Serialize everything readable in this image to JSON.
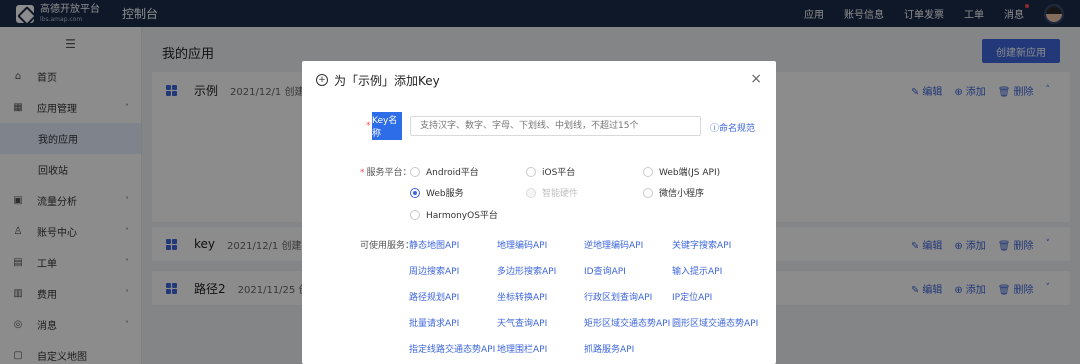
{
  "topbar": {
    "logo_cn": "高德开放平台",
    "logo_en": "lbs.amap.com",
    "console": "控制台",
    "nav": [
      "应用",
      "账号信息",
      "订单发票",
      "工单",
      "消息"
    ]
  },
  "sidebar": {
    "collapse_icon": "☰",
    "items": [
      {
        "label": "首页",
        "icon": "⌂"
      },
      {
        "label": "应用管理",
        "icon": "▦",
        "arrow": "˄"
      },
      {
        "label": "我的应用"
      },
      {
        "label": "回收站"
      },
      {
        "label": "流量分析",
        "icon": "▣",
        "arrow": "˅"
      },
      {
        "label": "账号中心",
        "icon": "♙",
        "arrow": "˅"
      },
      {
        "label": "工单",
        "icon": "▤",
        "arrow": "˅"
      },
      {
        "label": "费用",
        "icon": "▥",
        "arrow": "˅"
      },
      {
        "label": "消息",
        "icon": "◎",
        "arrow": "˅"
      },
      {
        "label": "自定义地图",
        "icon": "▢"
      }
    ]
  },
  "main": {
    "title": "我的应用",
    "create_button": "创建新应用",
    "apps": [
      {
        "name": "示例",
        "date": "2021/12/1 创建",
        "toggle": "˄"
      },
      {
        "name": "key",
        "date": "2021/12/1 创建",
        "toggle": "˅"
      },
      {
        "name": "路径2",
        "date": "2021/11/25 创建",
        "toggle": "˅"
      }
    ],
    "actions": {
      "edit": "编辑",
      "add": "添加",
      "delete": "删除"
    }
  },
  "modal": {
    "title": "为「示例」添加Key",
    "close": "×",
    "key_name_label": "Key名称",
    "key_name_placeholder": "支持汉字、数字、字母、下划线、中划线，不超过15个",
    "naming_rule": "命名规范",
    "platform_label": "服务平台：",
    "platforms": [
      {
        "label": "Android平台",
        "checked": false,
        "disabled": false
      },
      {
        "label": "iOS平台",
        "checked": false,
        "disabled": false
      },
      {
        "label": "Web端(JS API)",
        "checked": false,
        "disabled": false
      },
      {
        "label": "Web服务",
        "checked": true,
        "disabled": false
      },
      {
        "label": "智能硬件",
        "checked": false,
        "disabled": true
      },
      {
        "label": "微信小程序",
        "checked": false,
        "disabled": false
      },
      {
        "label": "HarmonyOS平台",
        "checked": false,
        "disabled": false
      }
    ],
    "services_label": "可使用服务：",
    "services": [
      "静态地图API",
      "地理编码API",
      "逆地理编码API",
      "关键字搜索API",
      "周边搜索API",
      "多边形搜索API",
      "ID查询API",
      "输入提示API",
      "路径规划API",
      "坐标转换API",
      "行政区划查询API",
      "IP定位API",
      "批量请求API",
      "天气查询API",
      "矩形区域交通态势API",
      "圆形区域交通态势API",
      "指定线路交通态势API",
      "地理围栏API",
      "抓路服务API"
    ]
  }
}
